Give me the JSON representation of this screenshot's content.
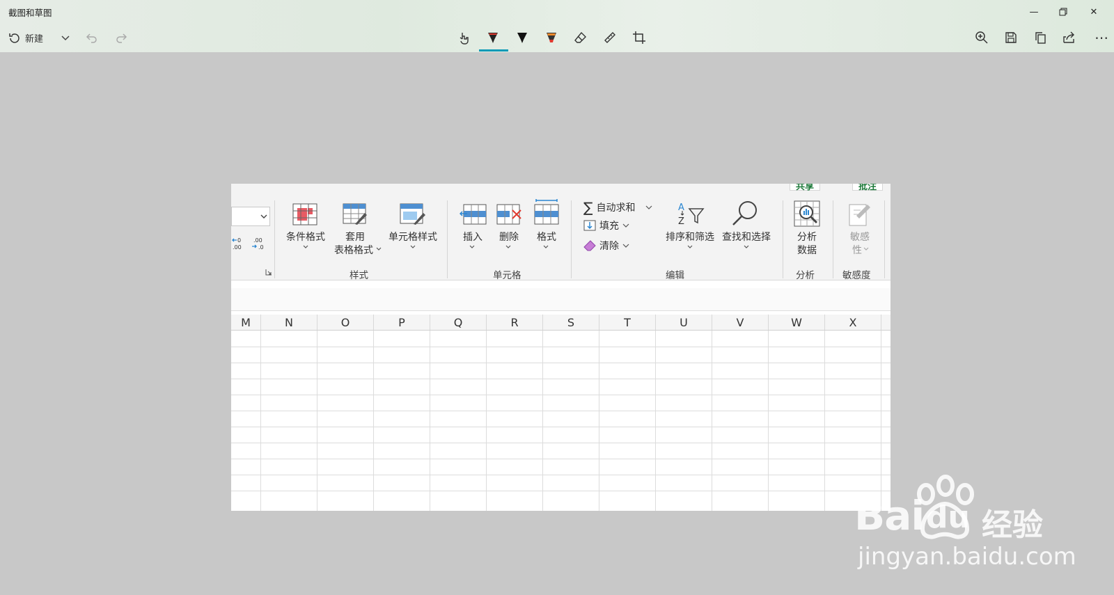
{
  "app": {
    "title": "截图和草图"
  },
  "window": {
    "minimize_icon": "minimize-icon",
    "restore_icon": "restore-icon",
    "close_icon": "close-icon"
  },
  "toolbar": {
    "new_label": "新建",
    "tools": [
      "touch-writing-icon",
      "ballpoint-pen-icon",
      "pencil-icon",
      "highlighter-icon",
      "eraser-icon",
      "ruler-icon",
      "crop-icon"
    ],
    "right_tools": [
      "zoom-icon",
      "save-icon",
      "copy-icon",
      "share-icon",
      "more-icon"
    ],
    "active_pen_color": "#e03a2f"
  },
  "excel": {
    "ribbon": {
      "format_number": {
        "increase_decimal": ".00\n→.0",
        "decrease_decimal": "←.0\n.00"
      },
      "styles": {
        "conditional_format": "条件格式",
        "format_as_table_1": "套用",
        "format_as_table_2": "表格格式",
        "cell_styles": "单元格样式",
        "group": "样式"
      },
      "cells": {
        "insert": "插入",
        "delete": "删除",
        "format": "格式",
        "group": "单元格"
      },
      "editing": {
        "autosum": "自动求和",
        "fill": "填充",
        "clear": "清除",
        "sort_filter": "排序和筛选",
        "find_select": "查找和选择",
        "group": "编辑"
      },
      "analysis": {
        "analyze_1": "分析",
        "analyze_2": "数据",
        "group": "分析"
      },
      "sensitivity": {
        "label_1": "敏感",
        "label_2": "性",
        "group": "敏感度"
      },
      "top_peek": [
        "共享",
        "批注"
      ]
    },
    "columns": [
      "M",
      "N",
      "O",
      "P",
      "Q",
      "R",
      "S",
      "T",
      "U",
      "V",
      "W",
      "X"
    ]
  },
  "watermark": {
    "bai": "Bai",
    "du": "du",
    "jingyan": "经验",
    "url": "jingyan.baidu.com"
  }
}
